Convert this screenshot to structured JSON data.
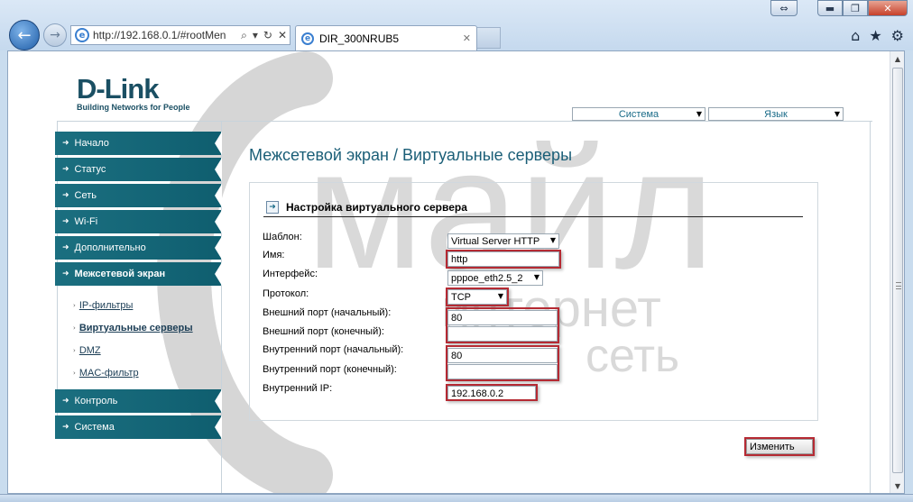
{
  "browser": {
    "address": "http://192.168.0.1/#rootMen",
    "tab_title": "DIR_300NRUB5",
    "window_buttons": {
      "restore": "⇔",
      "minimize": "▬",
      "maximize": "❐",
      "close": "✕"
    },
    "address_controls": [
      "⌕",
      "▾",
      "↻",
      "✕"
    ],
    "tab_close": "✕",
    "tools": [
      "⌂",
      "★",
      "⚙"
    ]
  },
  "logo": {
    "brand": "D-Link",
    "slogan": "Building Networks for People"
  },
  "top": {
    "system_select": "Система",
    "language_select": "Язык"
  },
  "menu": {
    "items": [
      {
        "label": "Начало"
      },
      {
        "label": "Статус"
      },
      {
        "label": "Сеть"
      },
      {
        "label": "Wi-Fi"
      },
      {
        "label": "Дополнительно"
      },
      {
        "label": "Межсетевой экран"
      },
      {
        "label": "Контроль"
      },
      {
        "label": "Система"
      }
    ],
    "subitems": [
      {
        "label": "IP-фильтры"
      },
      {
        "label": "Виртуальные серверы"
      },
      {
        "label": "DMZ"
      },
      {
        "label": "MAC-фильтр"
      }
    ]
  },
  "page": {
    "title": "Межсетевой экран / Виртуальные серверы"
  },
  "form": {
    "heading": "Настройка виртуального сервера",
    "labels": {
      "template": "Шаблон:",
      "name": "Имя:",
      "interface": "Интерфейс:",
      "protocol": "Протокол:",
      "ext_port_start": "Внешний порт (начальный):",
      "ext_port_end": "Внешний порт (конечный):",
      "int_port_start": "Внутренний порт (начальный):",
      "int_port_end": "Внутренний порт (конечный):",
      "int_ip": "Внутренний IP:"
    },
    "values": {
      "template": "Virtual Server HTTP",
      "name": "http",
      "interface": "pppoe_eth2.5_2",
      "protocol": "TCP",
      "ext_port_start": "80",
      "ext_port_end": "",
      "int_port_start": "80",
      "int_port_end": "",
      "int_ip": "192.168.0.2"
    },
    "submit": "Изменить"
  },
  "watermark": {
    "line1": "майл",
    "line2": "интернет",
    "line3": "сеть"
  }
}
